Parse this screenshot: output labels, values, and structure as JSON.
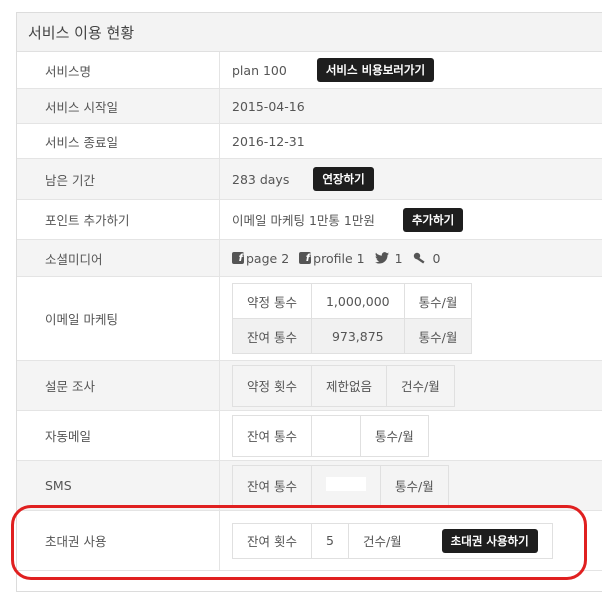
{
  "panel": {
    "title": "서비스 이용 현황"
  },
  "rows": {
    "service_name": {
      "label": "서비스명",
      "value": "plan 100",
      "button": "서비스 비용보러가기"
    },
    "start_date": {
      "label": "서비스 시작일",
      "value": "2015-04-16"
    },
    "end_date": {
      "label": "서비스 종료일",
      "value": "2016-12-31"
    },
    "remaining": {
      "label": "남은 기간",
      "value": "283 days",
      "button": "연장하기"
    },
    "points": {
      "label": "포인트 추가하기",
      "value": "이메일 마케팅 1만통 1만원",
      "button": "추가하기"
    },
    "social": {
      "label": "소셜미디어",
      "facebook_page": "page 2",
      "facebook_profile": "profile 1",
      "twitter": "1",
      "other": "0"
    },
    "email_marketing": {
      "label": "이메일 마케팅",
      "contract_label": "약정 통수",
      "contract_value": "1,000,000",
      "contract_unit": "통수/월",
      "remain_label": "잔여 통수",
      "remain_value": "973,875",
      "remain_unit": "통수/월"
    },
    "survey": {
      "label": "설문 조사",
      "col1": "약정 횟수",
      "col2": "제한없음",
      "col3": "건수/월"
    },
    "auto_mail": {
      "label": "자동메일",
      "col1": "잔여 통수",
      "col3": "통수/월"
    },
    "sms": {
      "label": "SMS",
      "col1": "잔여 통수",
      "col3": "통수/월"
    },
    "invite": {
      "label": "초대권 사용",
      "col1": "잔여 횟수",
      "col2": "5",
      "col3": "건수/월",
      "button": "초대권 사용하기"
    }
  }
}
